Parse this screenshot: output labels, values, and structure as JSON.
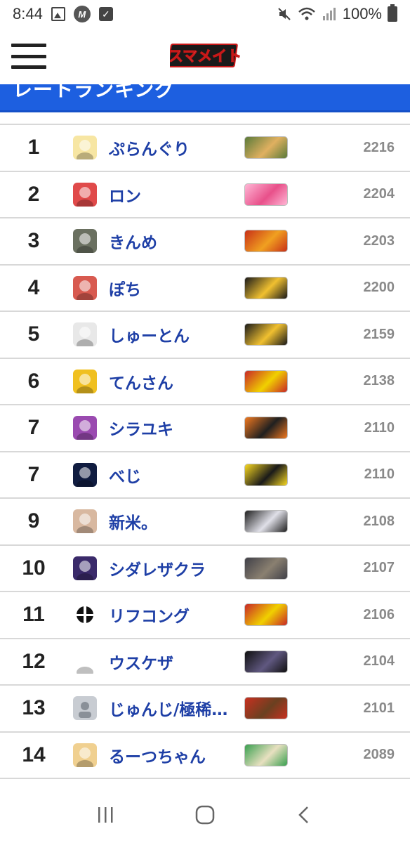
{
  "status_bar": {
    "time": "8:44",
    "battery": "100%",
    "icons": [
      "image-icon",
      "m-app-icon",
      "checkbox-icon",
      "mute-icon",
      "wifi-icon",
      "signal-icon",
      "battery-icon"
    ]
  },
  "header": {
    "logo_text": "スマメイト",
    "menu_icon": "hamburger-menu-icon"
  },
  "section": {
    "title": "レートランキング"
  },
  "ranking": [
    {
      "rank": "1",
      "name": "ぷらんぐり",
      "rating": "2216",
      "avatar_color": "#f7e6a3",
      "char_colors": [
        "#5a7a3a",
        "#e0b060"
      ]
    },
    {
      "rank": "2",
      "name": "ロン",
      "rating": "2204",
      "avatar_color": "#e04a4a",
      "char_colors": [
        "#ffb6d5",
        "#e8508a"
      ]
    },
    {
      "rank": "3",
      "name": "きんめ",
      "rating": "2203",
      "avatar_color": "#6a7060",
      "char_colors": [
        "#c83018",
        "#f0a020"
      ]
    },
    {
      "rank": "4",
      "name": "ぽち",
      "rating": "2200",
      "avatar_color": "#d85a50",
      "char_colors": [
        "#1a1a1a",
        "#f0c030"
      ]
    },
    {
      "rank": "5",
      "name": "しゅーとん",
      "rating": "2159",
      "avatar_color": "#e8e8e8",
      "char_colors": [
        "#1a1a1a",
        "#f0c030"
      ]
    },
    {
      "rank": "6",
      "name": "てんさん",
      "rating": "2138",
      "avatar_color": "#f0c020",
      "char_colors": [
        "#c82828",
        "#f0d000"
      ]
    },
    {
      "rank": "7",
      "name": "シラユキ",
      "rating": "2110",
      "avatar_color": "#9a4ab0",
      "char_colors": [
        "#f07820",
        "#202020"
      ]
    },
    {
      "rank": "7",
      "name": "べじ",
      "rating": "2110",
      "avatar_color": "#101c40",
      "char_colors": [
        "#f8d820",
        "#1a1a1a"
      ]
    },
    {
      "rank": "9",
      "name": "新米。",
      "rating": "2108",
      "avatar_color": "#d8b8a0",
      "char_colors": [
        "#202020",
        "#e0e0e8"
      ]
    },
    {
      "rank": "10",
      "name": "シダレザクラ",
      "rating": "2107",
      "avatar_color": "#3a2a6a",
      "char_colors": [
        "#404048",
        "#8a8070"
      ]
    },
    {
      "rank": "11",
      "name": "リフコング",
      "rating": "2106",
      "avatar_color": "#ffffff",
      "char_colors": [
        "#c82828",
        "#f0d000"
      ]
    },
    {
      "rank": "12",
      "name": "ウスケザ",
      "rating": "2104",
      "avatar_color": "#ffffff",
      "char_colors": [
        "#101010",
        "#605880"
      ]
    },
    {
      "rank": "13",
      "name": "じゅんじ/極稀…",
      "rating": "2101",
      "avatar_color": "#c8ccd2",
      "char_colors": [
        "#c83020",
        "#6a4020"
      ]
    },
    {
      "rank": "14",
      "name": "るーつちゃん",
      "rating": "2089",
      "avatar_color": "#f0d090",
      "char_colors": [
        "#3aa050",
        "#e8e0c0"
      ]
    }
  ],
  "nav": {
    "recents": "recents-icon",
    "home": "home-icon",
    "back": "back-icon"
  }
}
